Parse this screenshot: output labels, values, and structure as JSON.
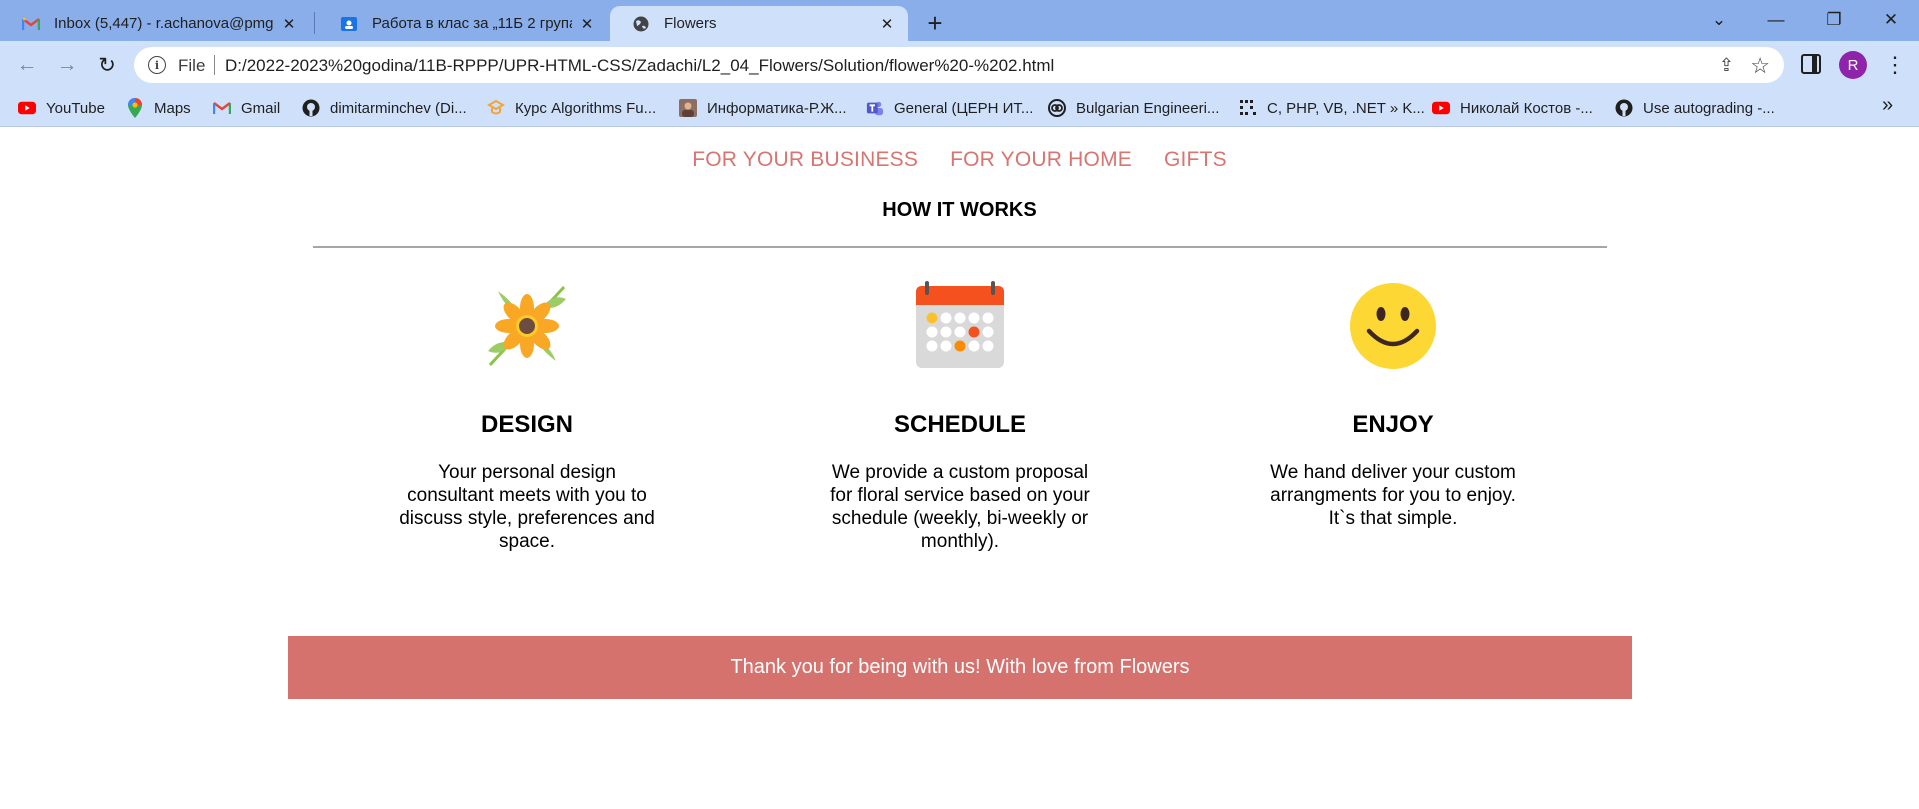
{
  "browser": {
    "tabs": [
      {
        "title": "Inbox (5,447) - r.achanova@pmg",
        "icon": "gmail-icon",
        "active": false
      },
      {
        "title": "Работа в клас за „11Б 2 група Р",
        "icon": "classroom-icon",
        "active": false
      },
      {
        "title": "Flowers",
        "icon": "globe-icon",
        "active": true
      }
    ],
    "address": {
      "scheme_label": "File",
      "url": "D:/2022-2023%20godina/11B-RPPP/UPR-HTML-CSS/Zadachi/L2_04_Flowers/Solution/flower%20-%202.html"
    },
    "profile_initial": "R",
    "bookmarks": [
      {
        "label": "YouTube",
        "icon": "youtube-icon"
      },
      {
        "label": "Maps",
        "icon": "maps-icon"
      },
      {
        "label": "Gmail",
        "icon": "gmail-icon"
      },
      {
        "label": "dimitarminchev (Di...",
        "icon": "github-icon"
      },
      {
        "label": "Курс Algorithms Fu...",
        "icon": "course-icon"
      },
      {
        "label": "Информатика-Р.Ж...",
        "icon": "photo-icon"
      },
      {
        "label": "General (ЦЕРН ИТ...",
        "icon": "teams-icon"
      },
      {
        "label": "Bulgarian Engineeri...",
        "icon": "bulgarian-engineering-icon"
      },
      {
        "label": "C, PHP, VB, .NET » K...",
        "icon": "code-icon"
      },
      {
        "label": "Николай Костов -...",
        "icon": "youtube-icon"
      },
      {
        "label": "Use autograding -...",
        "icon": "github-icon"
      }
    ]
  },
  "page": {
    "nav": [
      "FOR YOUR BUSINESS",
      "FOR YOUR HOME",
      "GIFTS"
    ],
    "section_title": "HOW IT WORKS",
    "features": [
      {
        "title": "DESIGN",
        "text": "Your personal design consultant meets with you to discuss style, preferences and space.",
        "icon": "flower-icon"
      },
      {
        "title": "SCHEDULE",
        "text": "We provide a custom proposal for floral service based on your schedule (weekly, bi-weekly or monthly).",
        "icon": "calendar-icon"
      },
      {
        "title": "ENJOY",
        "text": "We hand deliver your custom arrangments for you to enjoy. It`s that simple.",
        "icon": "smiley-icon"
      }
    ],
    "footer_text": "Thank you for being with us! With love from Flowers"
  },
  "colors": {
    "tabstrip": "#8aaee9",
    "toolbar": "#cfe0fa",
    "accent": "#d77570",
    "footer_bg": "#d6726e",
    "rule": "#a6a6a6"
  }
}
